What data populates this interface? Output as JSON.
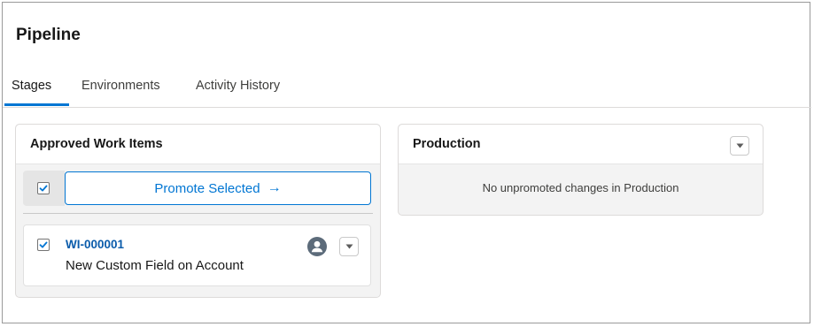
{
  "page": {
    "title": "Pipeline"
  },
  "tabs": [
    {
      "label": "Stages",
      "active": true
    },
    {
      "label": "Environments",
      "active": false
    },
    {
      "label": "Activity History",
      "active": false
    }
  ],
  "approved_card": {
    "title": "Approved Work Items",
    "select_all_checked": true,
    "promote_label": "Promote Selected",
    "promote_icon": "arrow-right-icon",
    "work_items": [
      {
        "id": "WI-000001",
        "name": "New Custom Field on Account",
        "checked": true
      }
    ]
  },
  "production_card": {
    "title": "Production",
    "empty_message": "No unpromoted changes in Production"
  },
  "colors": {
    "accent": "#0176d3",
    "link": "#0b5cab",
    "card_bg": "#f3f3f3",
    "avatar": "#5c6b7a"
  }
}
